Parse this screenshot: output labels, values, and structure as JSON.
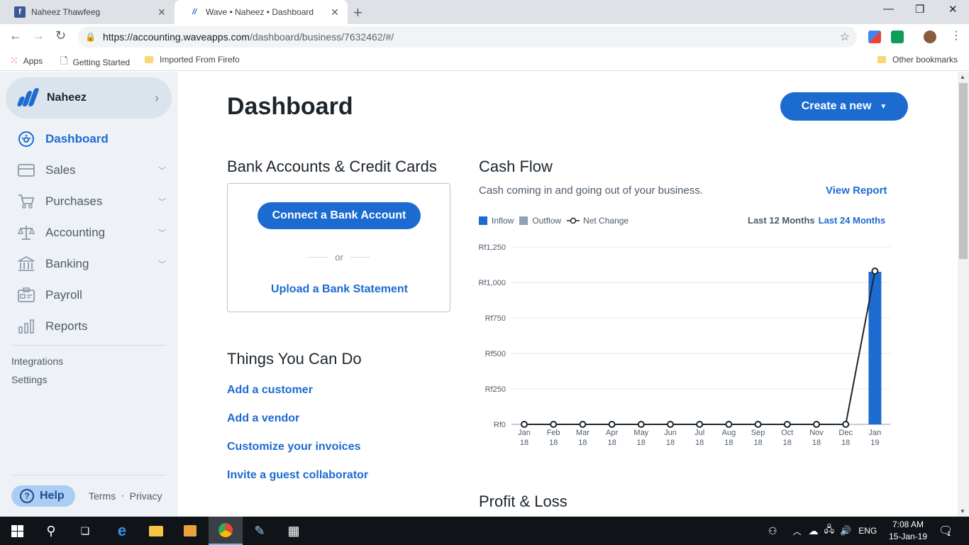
{
  "browser": {
    "tabs": [
      {
        "title": "Naheez Thawfeeg",
        "favicon": "facebook-icon",
        "active": false
      },
      {
        "title": "Wave • Naheez • Dashboard",
        "favicon": "wave-icon",
        "active": true
      }
    ],
    "url_host": "https://accounting.waveapps.com",
    "url_path": "/dashboard/business/7632462/#/",
    "bookmarks": [
      {
        "label": "Apps",
        "icon": "apps-grid-icon"
      },
      {
        "label": "Getting Started",
        "icon": "page-icon"
      },
      {
        "label": "Imported From Firefo",
        "icon": "folder-icon"
      }
    ],
    "other_bookmarks": "Other bookmarks"
  },
  "sidebar": {
    "business_name": "Naheez",
    "items": [
      {
        "label": "Dashboard",
        "icon": "dashboard-icon",
        "active": true,
        "expandable": false
      },
      {
        "label": "Sales",
        "icon": "sales-icon",
        "active": false,
        "expandable": true
      },
      {
        "label": "Purchases",
        "icon": "cart-icon",
        "active": false,
        "expandable": true
      },
      {
        "label": "Accounting",
        "icon": "scale-icon",
        "active": false,
        "expandable": true
      },
      {
        "label": "Banking",
        "icon": "bank-icon",
        "active": false,
        "expandable": true
      },
      {
        "label": "Payroll",
        "icon": "payroll-icon",
        "active": false,
        "expandable": false
      },
      {
        "label": "Reports",
        "icon": "reports-icon",
        "active": false,
        "expandable": false
      }
    ],
    "integrations": "Integrations",
    "settings": "Settings",
    "help": "Help",
    "terms": "Terms",
    "privacy": "Privacy",
    "sep": "•"
  },
  "main": {
    "title": "Dashboard",
    "create_button": "Create a new",
    "bank_section": {
      "title": "Bank Accounts & Credit Cards",
      "connect_button": "Connect a Bank Account",
      "or": "or",
      "upload_link": "Upload a Bank Statement"
    },
    "things": {
      "title": "Things You Can Do",
      "links": [
        "Add a customer",
        "Add a vendor",
        "Customize your invoices",
        "Invite a guest collaborator"
      ]
    },
    "cashflow": {
      "title": "Cash Flow",
      "subtitle": "Cash coming in and going out of your business.",
      "view_report": "View Report",
      "legend": {
        "inflow": "Inflow",
        "outflow": "Outflow",
        "net": "Net Change"
      },
      "range_12": "Last 12 Months",
      "range_24": "Last 24 Months"
    },
    "profit_loss_title": "Profit & Loss"
  },
  "taskbar": {
    "language": "ENG",
    "time": "7:08 AM",
    "date": "15-Jan-19",
    "notification_count": "1"
  },
  "colors": {
    "accent": "#1c6bd1",
    "inflow": "#1c6bd1",
    "outflow": "#8fa3b5",
    "net": "#1c252c"
  },
  "chart_data": {
    "type": "bar",
    "title": "Cash Flow",
    "categories": [
      [
        "Jan",
        "18"
      ],
      [
        "Feb",
        "18"
      ],
      [
        "Mar",
        "18"
      ],
      [
        "Apr",
        "18"
      ],
      [
        "May",
        "18"
      ],
      [
        "Jun",
        "18"
      ],
      [
        "Jul",
        "18"
      ],
      [
        "Aug",
        "18"
      ],
      [
        "Sep",
        "18"
      ],
      [
        "Oct",
        "18"
      ],
      [
        "Nov",
        "18"
      ],
      [
        "Dec",
        "18"
      ],
      [
        "Jan",
        "19"
      ]
    ],
    "series": [
      {
        "name": "Inflow",
        "type": "bar",
        "values": [
          0,
          0,
          0,
          0,
          0,
          0,
          0,
          0,
          0,
          0,
          0,
          0,
          1075
        ]
      },
      {
        "name": "Outflow",
        "type": "bar",
        "values": [
          0,
          0,
          0,
          0,
          0,
          0,
          0,
          0,
          0,
          0,
          0,
          0,
          0
        ]
      },
      {
        "name": "Net Change",
        "type": "line",
        "values": [
          0,
          0,
          0,
          0,
          0,
          0,
          0,
          0,
          0,
          0,
          0,
          0,
          1080
        ]
      }
    ],
    "yticks": [
      "Rf0",
      "Rf250",
      "Rf500",
      "Rf750",
      "Rf1,000",
      "Rf1,250"
    ],
    "ylim": [
      0,
      1250
    ],
    "grid": true,
    "legend": "top-left"
  }
}
